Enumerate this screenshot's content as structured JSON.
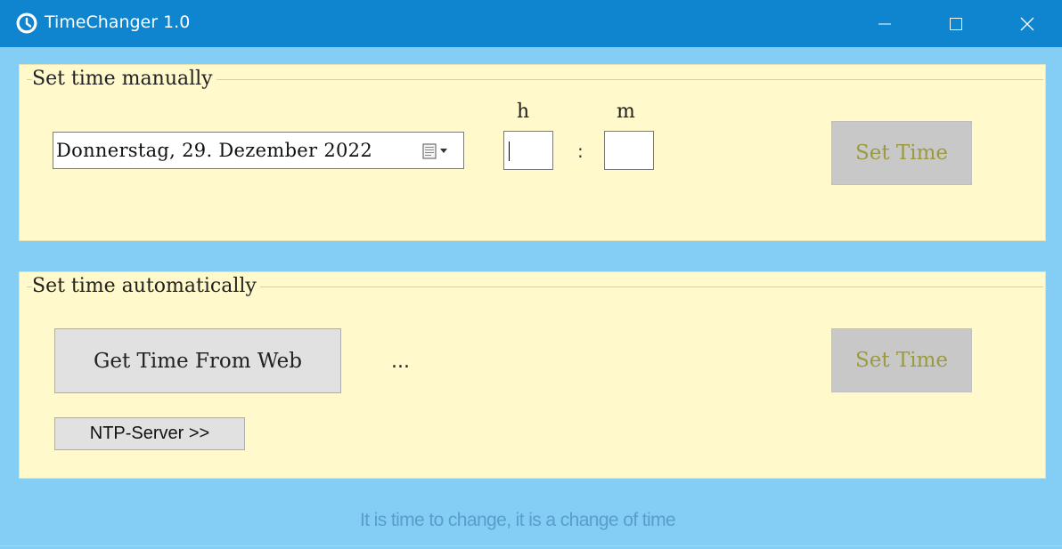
{
  "window": {
    "title": "TimeChanger 1.0",
    "icon": "clock-icon",
    "controls": [
      "minimize-icon",
      "maximize-icon",
      "close-icon"
    ]
  },
  "manual": {
    "legend": "Set time manually",
    "date_value": "Donnerstag, 29. Dezember 2022",
    "date_dropdown_icon": "calendar-dropdown-icon",
    "hour_label": "h",
    "minute_label": "m",
    "hour_value": "",
    "minute_value": "",
    "separator": ":",
    "set_time_label": "Set Time"
  },
  "auto": {
    "legend": "Set time automatically",
    "get_time_label": "Get Time From Web",
    "status": "...",
    "set_time_label": "Set Time",
    "ntp_label": "NTP-Server >>"
  },
  "footer": {
    "text": "It is time to change, it is a change of time"
  },
  "colors": {
    "titlebar": "#0f84cf",
    "background": "#84cdf5",
    "panel": "#fff9cc",
    "disabled_text": "#9c9a3e",
    "footer_text": "#5a9ecb"
  }
}
